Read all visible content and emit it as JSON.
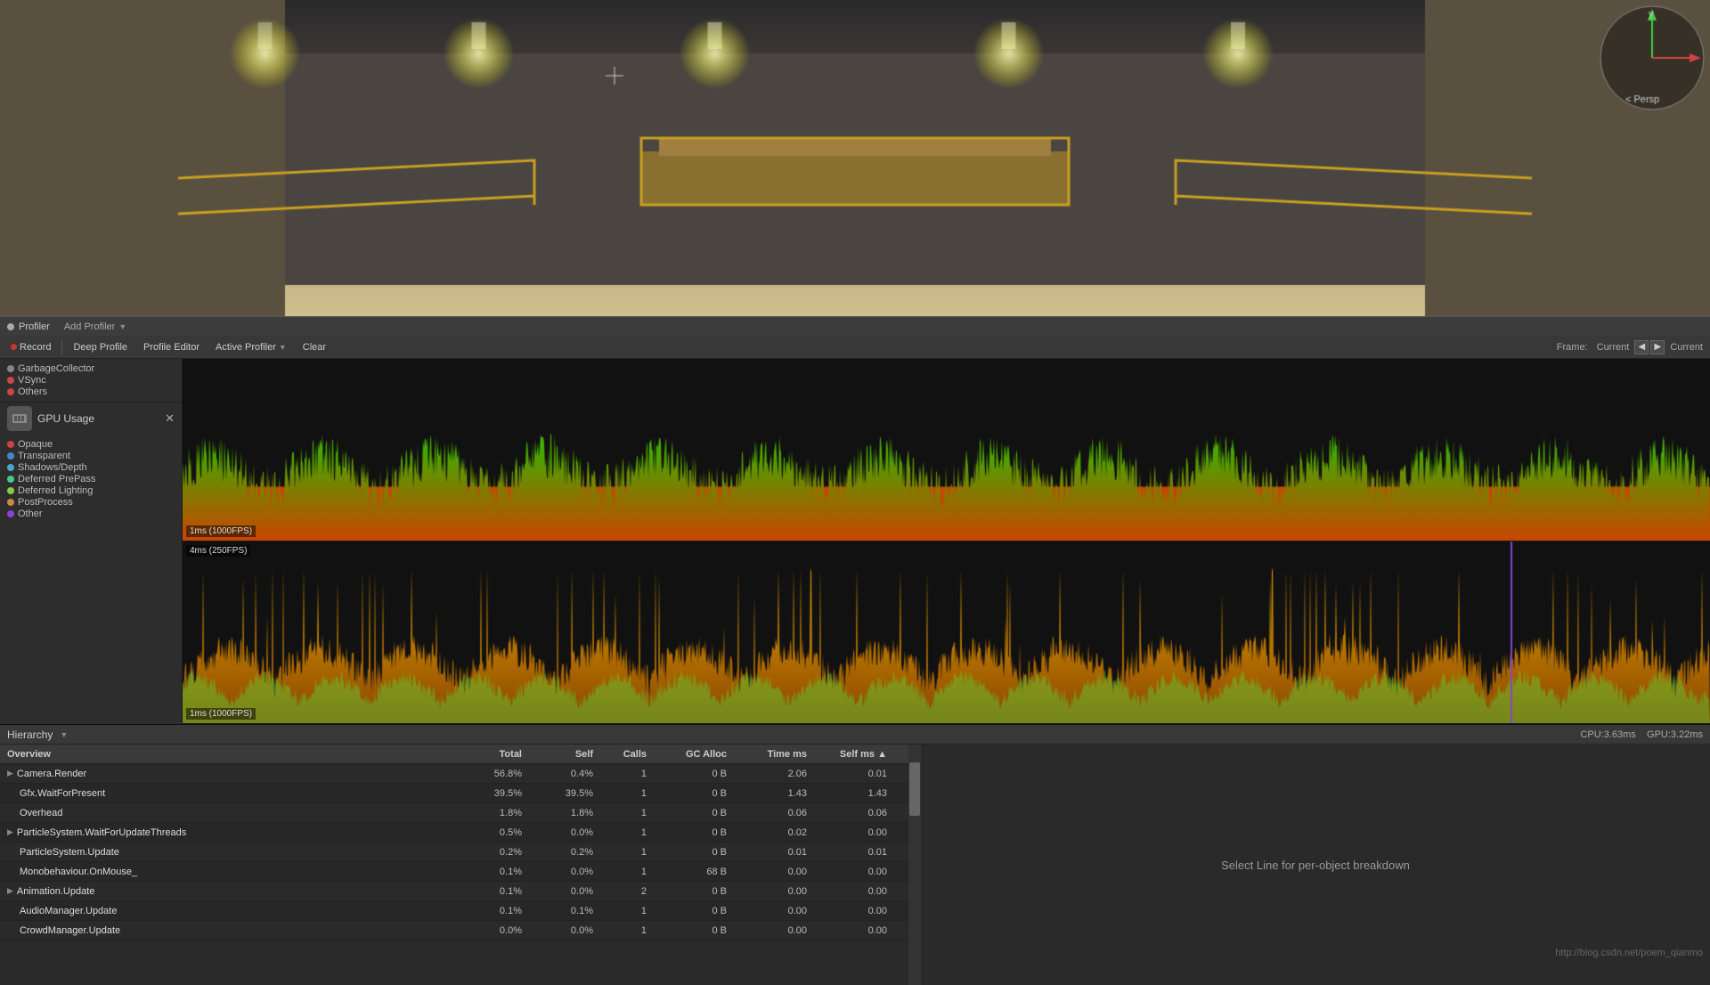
{
  "profiler": {
    "title": "Profiler",
    "add_profiler_label": "Add Profiler",
    "toolbar": {
      "record_label": "Record",
      "deep_profile_label": "Deep Profile",
      "profile_editor_label": "Profile Editor",
      "active_profiler_label": "Active Profiler",
      "clear_label": "Clear",
      "frame_label": "Frame:",
      "current_label": "Current",
      "current2_label": "Current"
    },
    "cpu_chart": {
      "label_bottom": "1ms (1000FPS)"
    },
    "gpu_chart": {
      "label_top": "4ms (250FPS)",
      "label_bottom": "1ms (1000FPS)"
    },
    "bottom_stats": {
      "cpu": "CPU:3.63ms",
      "gpu": "GPU:3.22ms"
    }
  },
  "left_panel": {
    "cpu_items": [
      {
        "label": "GarbageCollector",
        "color": "#888888"
      },
      {
        "label": "VSync",
        "color": "#cc4444"
      },
      {
        "label": "Others",
        "color": "#cc4444"
      }
    ],
    "gpu_title": "GPU Usage",
    "gpu_items": [
      {
        "label": "Opaque",
        "color": "#cc4444"
      },
      {
        "label": "Transparent",
        "color": "#4488cc"
      },
      {
        "label": "Shadows/Depth",
        "color": "#44aacc"
      },
      {
        "label": "Deferred PrePass",
        "color": "#44cc88"
      },
      {
        "label": "Deferred Lighting",
        "color": "#88cc44"
      },
      {
        "label": "PostProcess",
        "color": "#cc8844"
      },
      {
        "label": "Other",
        "color": "#8844cc"
      }
    ]
  },
  "hierarchy": {
    "dropdown_label": "Hierarchy",
    "table_headers": [
      "Overview",
      "Total",
      "Self",
      "Calls",
      "GC Alloc",
      "Time ms",
      "Self ms",
      ""
    ],
    "rows": [
      {
        "name": "Camera.Render",
        "total": "56.8%",
        "self": "0.4%",
        "calls": "1",
        "gc_alloc": "0 B",
        "time_ms": "2.06",
        "self_ms": "0.01",
        "expandable": true
      },
      {
        "name": "Gfx.WaitForPresent",
        "total": "39.5%",
        "self": "39.5%",
        "calls": "1",
        "gc_alloc": "0 B",
        "time_ms": "1.43",
        "self_ms": "1.43",
        "expandable": false
      },
      {
        "name": "Overhead",
        "total": "1.8%",
        "self": "1.8%",
        "calls": "1",
        "gc_alloc": "0 B",
        "time_ms": "0.06",
        "self_ms": "0.06",
        "expandable": false
      },
      {
        "name": "ParticleSystem.WaitForUpdateThreads",
        "total": "0.5%",
        "self": "0.0%",
        "calls": "1",
        "gc_alloc": "0 B",
        "time_ms": "0.02",
        "self_ms": "0.00",
        "expandable": true
      },
      {
        "name": "ParticleSystem.Update",
        "total": "0.2%",
        "self": "0.2%",
        "calls": "1",
        "gc_alloc": "0 B",
        "time_ms": "0.01",
        "self_ms": "0.01",
        "expandable": false
      },
      {
        "name": "Monobehaviour.OnMouse_",
        "total": "0.1%",
        "self": "0.0%",
        "calls": "1",
        "gc_alloc": "68 B",
        "time_ms": "0.00",
        "self_ms": "0.00",
        "expandable": false
      },
      {
        "name": "Animation.Update",
        "total": "0.1%",
        "self": "0.0%",
        "calls": "2",
        "gc_alloc": "0 B",
        "time_ms": "0.00",
        "self_ms": "0.00",
        "expandable": true
      },
      {
        "name": "AudioManager.Update",
        "total": "0.1%",
        "self": "0.1%",
        "calls": "1",
        "gc_alloc": "0 B",
        "time_ms": "0.00",
        "self_ms": "0.00",
        "expandable": false
      },
      {
        "name": "CrowdManager.Update",
        "total": "0.0%",
        "self": "0.0%",
        "calls": "1",
        "gc_alloc": "0 B",
        "time_ms": "0.00",
        "self_ms": "0.00",
        "expandable": false
      }
    ]
  },
  "right_panel": {
    "select_line_text": "Select Line for per-object breakdown"
  },
  "watermark": "http://blog.csdn.net/poem_qianmo"
}
